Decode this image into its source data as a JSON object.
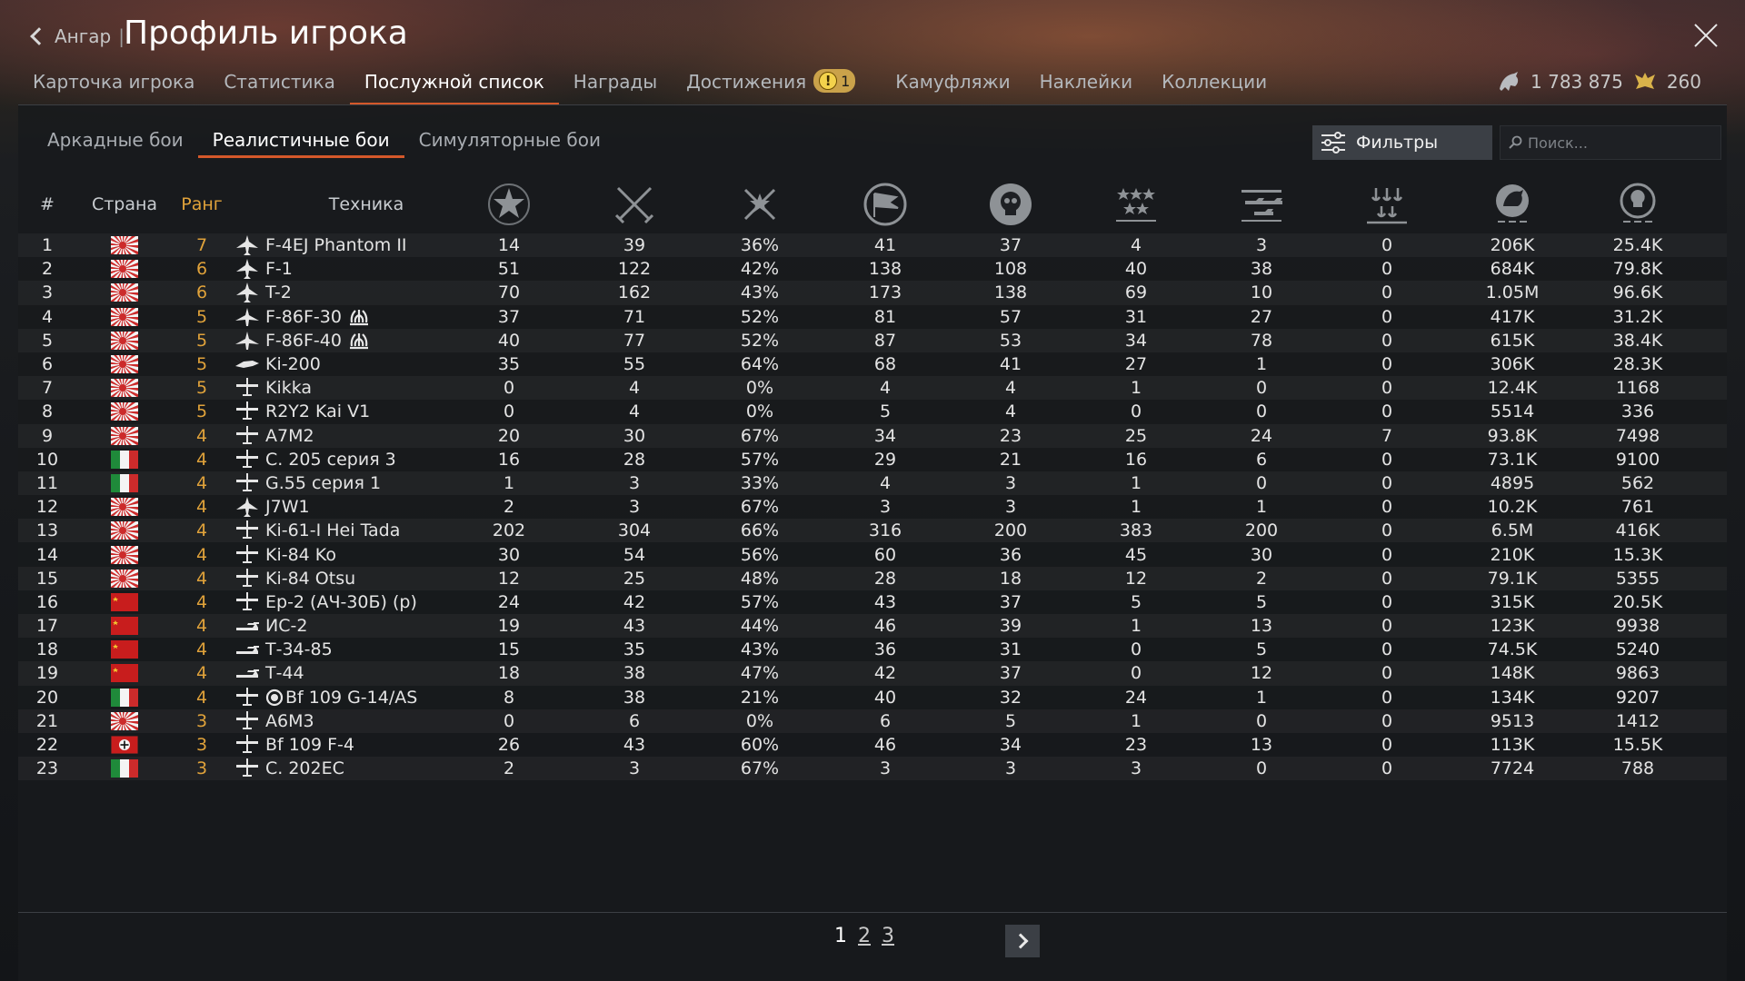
{
  "header": {
    "back_label": "Ангар",
    "separator": "|",
    "title": "Профиль игрока"
  },
  "tabs": [
    {
      "label": "Карточка игрока"
    },
    {
      "label": "Статистика"
    },
    {
      "label": "Послужной список",
      "active": true
    },
    {
      "label": "Награды"
    },
    {
      "label": "Достижения",
      "badge": "1"
    },
    {
      "label": "Камуфляжи"
    },
    {
      "label": "Наклейки"
    },
    {
      "label": "Коллекции"
    }
  ],
  "currency": {
    "silver": "1 783 875",
    "gold": "260"
  },
  "subtabs": [
    {
      "label": "Аркадные бои"
    },
    {
      "label": "Реалистичные бои",
      "active": true
    },
    {
      "label": "Симуляторные бои"
    }
  ],
  "filters_label": "Фильтры",
  "search_placeholder": "Поиск...",
  "columns": {
    "num": "#",
    "country": "Страна",
    "rank": "Ранг",
    "vehicle": "Техника",
    "icons": [
      "battles-icon",
      "victories-icon",
      "win-rate-icon",
      "respawns-icon",
      "deaths-icon",
      "air-kills-icon",
      "ground-kills-icon",
      "naval-kills-icon",
      "silver-lions-icon",
      "research-points-icon"
    ]
  },
  "rows": [
    {
      "n": "1",
      "flag": "japan",
      "rank": "7",
      "type": "jet",
      "name": "F-4EJ Phantom II",
      "v": [
        "14",
        "39",
        "36%",
        "41",
        "37",
        "4",
        "3",
        "0",
        "206K",
        "25.4K"
      ]
    },
    {
      "n": "2",
      "flag": "japan",
      "rank": "6",
      "type": "jet",
      "name": "F-1",
      "v": [
        "51",
        "122",
        "42%",
        "138",
        "108",
        "40",
        "38",
        "0",
        "684K",
        "79.8K"
      ]
    },
    {
      "n": "3",
      "flag": "japan",
      "rank": "6",
      "type": "jet",
      "name": "T-2",
      "v": [
        "70",
        "162",
        "43%",
        "173",
        "138",
        "69",
        "10",
        "0",
        "1.05M",
        "96.6K"
      ]
    },
    {
      "n": "4",
      "flag": "japan",
      "rank": "5",
      "type": "swept",
      "name": "F-86F-30",
      "premium": true,
      "v": [
        "37",
        "71",
        "52%",
        "81",
        "57",
        "31",
        "27",
        "0",
        "417K",
        "31.2K"
      ]
    },
    {
      "n": "5",
      "flag": "japan",
      "rank": "5",
      "type": "swept",
      "name": "F-86F-40",
      "premium": true,
      "v": [
        "40",
        "77",
        "52%",
        "87",
        "53",
        "34",
        "78",
        "0",
        "615K",
        "38.4K"
      ]
    },
    {
      "n": "6",
      "flag": "japan",
      "rank": "5",
      "type": "delta",
      "name": "Ki-200",
      "v": [
        "35",
        "55",
        "64%",
        "68",
        "41",
        "27",
        "1",
        "0",
        "306K",
        "28.3K"
      ]
    },
    {
      "n": "7",
      "flag": "japan",
      "rank": "5",
      "type": "prop",
      "name": "Kikka",
      "v": [
        "0",
        "4",
        "0%",
        "4",
        "4",
        "1",
        "0",
        "0",
        "12.4K",
        "1168"
      ]
    },
    {
      "n": "8",
      "flag": "japan",
      "rank": "5",
      "type": "prop",
      "name": "R2Y2 Kai V1",
      "v": [
        "0",
        "4",
        "0%",
        "5",
        "4",
        "0",
        "0",
        "0",
        "5514",
        "336"
      ]
    },
    {
      "n": "9",
      "flag": "japan",
      "rank": "4",
      "type": "prop",
      "name": "A7M2",
      "v": [
        "20",
        "30",
        "67%",
        "34",
        "23",
        "25",
        "24",
        "7",
        "93.8K",
        "7498"
      ]
    },
    {
      "n": "10",
      "flag": "italy",
      "rank": "4",
      "type": "prop",
      "name": "C. 205 серия 3",
      "v": [
        "16",
        "28",
        "57%",
        "29",
        "21",
        "16",
        "6",
        "0",
        "73.1K",
        "9100"
      ]
    },
    {
      "n": "11",
      "flag": "italy",
      "rank": "4",
      "type": "prop",
      "name": "G.55 серия 1",
      "v": [
        "1",
        "3",
        "33%",
        "4",
        "3",
        "1",
        "0",
        "0",
        "4895",
        "562"
      ]
    },
    {
      "n": "12",
      "flag": "japan",
      "rank": "4",
      "type": "jet",
      "name": "J7W1",
      "v": [
        "2",
        "3",
        "67%",
        "3",
        "3",
        "1",
        "1",
        "0",
        "10.2K",
        "761"
      ]
    },
    {
      "n": "13",
      "flag": "japan",
      "rank": "4",
      "type": "prop",
      "name": "Ki-61-I Hei Tada",
      "v": [
        "202",
        "304",
        "66%",
        "316",
        "200",
        "383",
        "200",
        "0",
        "6.5M",
        "416K"
      ]
    },
    {
      "n": "14",
      "flag": "japan",
      "rank": "4",
      "type": "prop",
      "name": "Ki-84 Ko",
      "v": [
        "30",
        "54",
        "56%",
        "60",
        "36",
        "45",
        "30",
        "0",
        "210K",
        "15.3K"
      ]
    },
    {
      "n": "15",
      "flag": "japan",
      "rank": "4",
      "type": "prop",
      "name": "Ki-84 Otsu",
      "v": [
        "12",
        "25",
        "48%",
        "28",
        "18",
        "12",
        "2",
        "0",
        "79.1K",
        "5355"
      ]
    },
    {
      "n": "16",
      "flag": "ussr",
      "rank": "4",
      "type": "bomber",
      "name": "Ер-2 (АЧ-30Б) (р)",
      "v": [
        "24",
        "42",
        "57%",
        "43",
        "37",
        "5",
        "5",
        "0",
        "315K",
        "20.5K"
      ]
    },
    {
      "n": "17",
      "flag": "ussr",
      "rank": "4",
      "type": "tank",
      "name": "ИС-2",
      "v": [
        "19",
        "43",
        "44%",
        "46",
        "39",
        "1",
        "13",
        "0",
        "123K",
        "9938"
      ]
    },
    {
      "n": "18",
      "flag": "ussr",
      "rank": "4",
      "type": "tank",
      "name": "Т-34-85",
      "v": [
        "15",
        "35",
        "43%",
        "36",
        "31",
        "0",
        "5",
        "0",
        "74.5K",
        "5240"
      ]
    },
    {
      "n": "19",
      "flag": "ussr",
      "rank": "4",
      "type": "tank",
      "name": "Т-44",
      "v": [
        "18",
        "38",
        "47%",
        "42",
        "37",
        "0",
        "12",
        "0",
        "148K",
        "9863"
      ]
    },
    {
      "n": "20",
      "flag": "italy",
      "rank": "4",
      "type": "prop",
      "name": "Bf 109 G-14/AS",
      "roundel": true,
      "v": [
        "8",
        "38",
        "21%",
        "40",
        "32",
        "24",
        "1",
        "0",
        "134K",
        "9207"
      ]
    },
    {
      "n": "21",
      "flag": "japan",
      "rank": "3",
      "type": "prop",
      "name": "A6M3",
      "v": [
        "0",
        "6",
        "0%",
        "6",
        "5",
        "1",
        "0",
        "0",
        "9513",
        "1412"
      ]
    },
    {
      "n": "22",
      "flag": "germany",
      "rank": "3",
      "type": "prop",
      "name": "Bf 109 F-4",
      "v": [
        "26",
        "43",
        "60%",
        "46",
        "34",
        "23",
        "13",
        "0",
        "113K",
        "15.5K"
      ]
    },
    {
      "n": "23",
      "flag": "italy",
      "rank": "3",
      "type": "prop",
      "name": "C. 202EC",
      "v": [
        "2",
        "3",
        "67%",
        "3",
        "3",
        "3",
        "0",
        "0",
        "7724",
        "788"
      ]
    }
  ],
  "pagination": {
    "pages": [
      "1",
      "2",
      "3"
    ],
    "current": "1"
  },
  "colors": {
    "accent": "#d4582a",
    "rank": "#e0a23a"
  }
}
